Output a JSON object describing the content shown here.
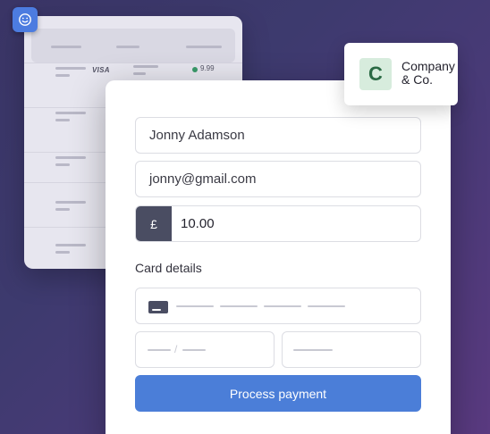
{
  "table_card": {
    "card_brand": "VISA",
    "amount": "9.99"
  },
  "company": {
    "logo_letter": "C",
    "name": "Company & Co."
  },
  "form": {
    "name_value": "Jonny Adamson",
    "email_value": "jonny@gmail.com",
    "currency_symbol": "£",
    "amount_value": "10.00",
    "card_details_label": "Card details",
    "submit_label": "Process payment"
  },
  "colors": {
    "accent": "#4b7ed8",
    "currency_bg": "#4a4d62",
    "logo_bg": "#d7ecdd",
    "status_green": "#3a9a6a"
  },
  "icons": [
    "smiley-icon",
    "card-icon"
  ]
}
